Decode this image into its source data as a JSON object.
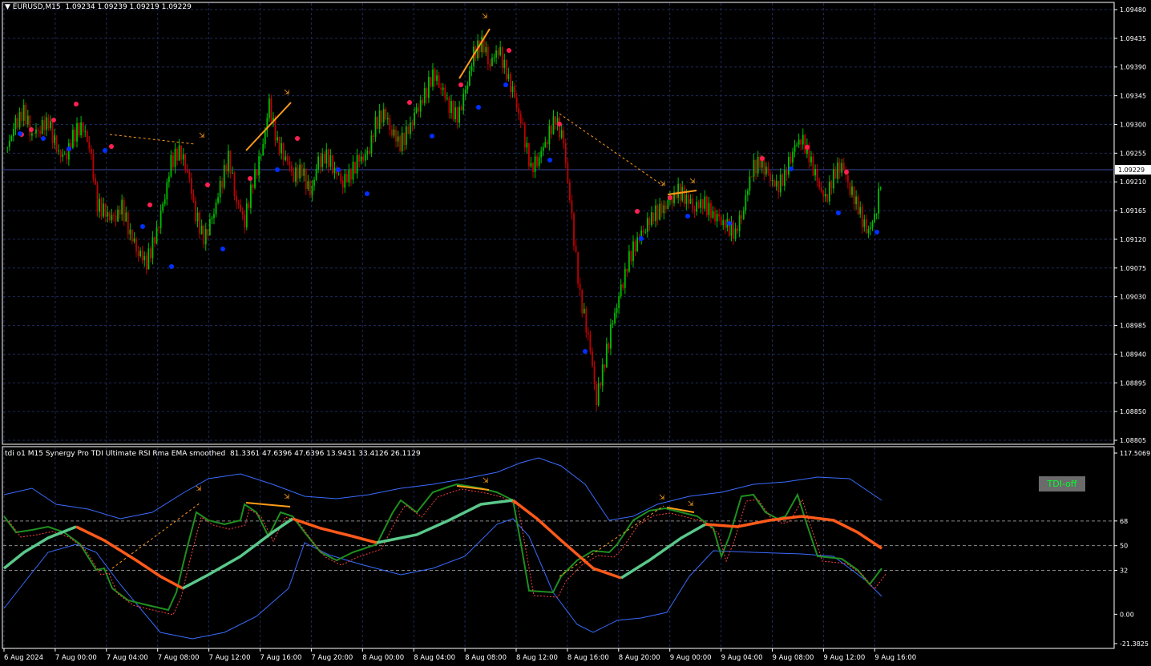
{
  "symbol_header": {
    "symbol": "EURUSD,M15",
    "ohlc": "1.09234 1.09239 1.09219 1.09229"
  },
  "main_chart": {
    "price_axis": [
      "1.09480",
      "1.09435",
      "1.09390",
      "1.09345",
      "1.09300",
      "1.09255",
      "1.09210",
      "1.09165",
      "1.09120",
      "1.09075",
      "1.09030",
      "1.08985",
      "1.08940",
      "1.08895",
      "1.08850",
      "1.08805"
    ],
    "current_price": "1.09229",
    "colors": {
      "bull": "#00c000",
      "bear": "#c00000",
      "grid": "#1e2a5a",
      "dot_high": "#ff2050",
      "dot_low": "#0030ff",
      "divergence": "#ff9c1a"
    }
  },
  "indicator": {
    "title": "tdi o1 M15 Synergy Pro TDI Ultimate RSI Rma EMA smoothed",
    "values": "81.3361 47.6396 47.6396 13.9431 33.4126 26.1129",
    "axis": [
      "117.5069",
      "68",
      "50",
      "32",
      "0.00",
      "-21.3825"
    ],
    "button_label": "TDI-off",
    "colors": {
      "band": "#3a6cff",
      "rsi": "#1f8f1f",
      "signal": "#ff4040",
      "market_base_up": "#5ac88a",
      "market_base_down": "#ff5a1a"
    }
  },
  "time_axis": [
    "6 Aug 2024",
    "7 Aug 00:00",
    "7 Aug 04:00",
    "7 Aug 08:00",
    "7 Aug 12:00",
    "7 Aug 16:00",
    "7 Aug 20:00",
    "8 Aug 00:00",
    "8 Aug 04:00",
    "8 Aug 08:00",
    "8 Aug 12:00",
    "8 Aug 16:00",
    "8 Aug 20:00",
    "9 Aug 00:00",
    "9 Aug 04:00",
    "9 Aug 08:00",
    "9 Aug 12:00",
    "9 Aug 16:00"
  ],
  "candle_path": [
    1.09265,
    1.093,
    1.0932,
    1.09285,
    1.09295,
    1.09305,
    1.0926,
    1.09245,
    1.0928,
    1.093,
    1.0927,
    1.09175,
    1.0916,
    1.0915,
    1.0917,
    1.0913,
    1.091,
    1.09085,
    1.0912,
    1.0917,
    1.0924,
    1.0926,
    1.0923,
    1.0916,
    1.0912,
    1.0915,
    1.092,
    1.0925,
    1.0918,
    1.0915,
    1.0921,
    1.0925,
    1.0933,
    1.0927,
    1.0925,
    1.0922,
    1.0923,
    1.0919,
    1.0924,
    1.0925,
    1.0923,
    1.0921,
    1.09225,
    1.09245,
    1.0925,
    1.093,
    1.0932,
    1.0929,
    1.0927,
    1.0929,
    1.0932,
    1.09345,
    1.0938,
    1.0936,
    1.0933,
    1.0931,
    1.0935,
    1.0941,
    1.0943,
    1.09395,
    1.0942,
    1.0938,
    1.0934,
    1.0929,
    1.0923,
    1.0925,
    1.0928,
    1.0931,
    1.0927,
    1.0915,
    1.0903,
    1.0897,
    1.0887,
    1.0893,
    1.0899,
    1.0904,
    1.0909,
    1.0912,
    1.0914,
    1.0916,
    1.09165,
    1.0918,
    1.09195,
    1.09185,
    1.0917,
    1.0918,
    1.0916,
    1.0915,
    1.0914,
    1.0913,
    1.0917,
    1.0923,
    1.0924,
    1.0922,
    1.092,
    1.0922,
    1.0926,
    1.0928,
    1.0925,
    1.0921,
    1.0918,
    1.0922,
    1.0924,
    1.092,
    1.0917,
    1.0913,
    1.0915,
    1.0923
  ]
}
